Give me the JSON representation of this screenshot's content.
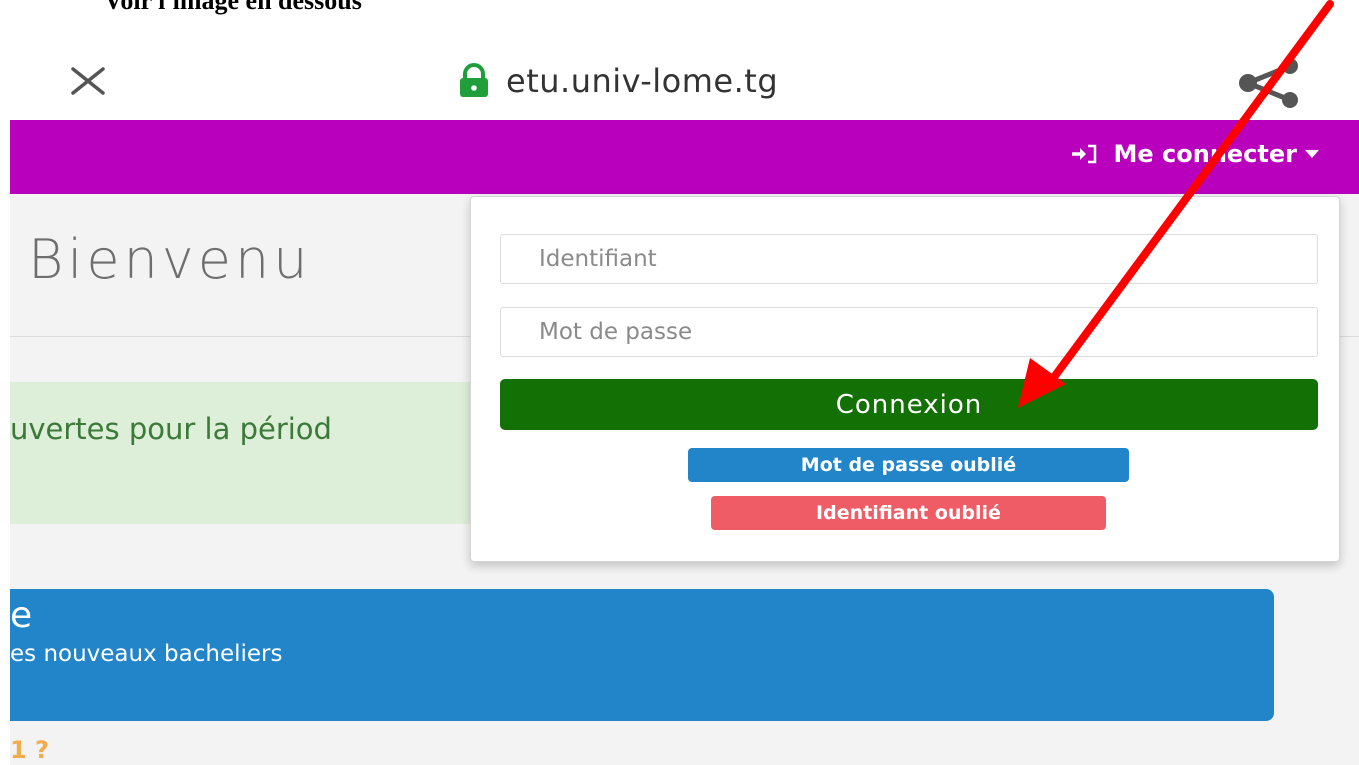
{
  "caption": "Voir l'image en dessous",
  "browser": {
    "url": "etu.univ-lome.tg",
    "close_icon": "close-icon",
    "lock_icon": "lock-icon",
    "share_icon": "share-icon"
  },
  "navbar": {
    "login_label": "Me connecter",
    "background": "#b800bd"
  },
  "main": {
    "welcome": "Bienvenu",
    "alert_text": "uvertes pour la périod",
    "info_title": "e",
    "info_text": "es nouveaux bacheliers",
    "footer_link": "1 ?"
  },
  "login_dropdown": {
    "identifier_placeholder": "Identifiant",
    "password_placeholder": "Mot de passe",
    "connect_label": "Connexion",
    "forgot_password_label": "Mot de passe oublié",
    "forgot_identifier_label": "Identifiant oublié"
  },
  "colors": {
    "connect_button": "#127005",
    "forgot_password_button": "#2285c9",
    "forgot_identifier_button": "#ef5c65",
    "annotation_arrow": "#ff0000"
  }
}
